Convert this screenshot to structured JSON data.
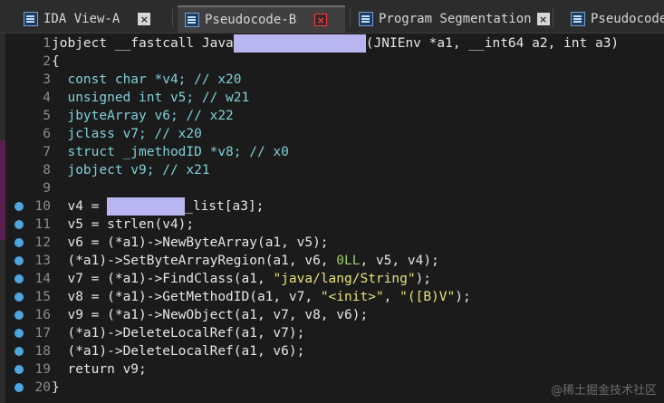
{
  "tabs": [
    {
      "label": "IDA View-A",
      "active": false,
      "close": "gray"
    },
    {
      "label": "Pseudocode-B",
      "active": true,
      "close": "red"
    },
    {
      "label": "Program Segmentation",
      "active": false,
      "close": "gray"
    },
    {
      "label": "Pseudocode",
      "active": false,
      "close": "none"
    }
  ],
  "close_glyph": "×",
  "code_lines": [
    {
      "n": "1",
      "bp": false,
      "parts": [
        [
          "kw",
          "jobject __fastcall Java"
        ],
        [
          "redact",
          ""
        ],
        [
          "kw",
          "(JNIEnv *a1, __int64 a2, int a3)"
        ]
      ]
    },
    {
      "n": "2",
      "bp": false,
      "parts": [
        [
          "kw",
          "{"
        ]
      ]
    },
    {
      "n": "3",
      "bp": false,
      "parts": [
        [
          "cmt",
          "  const char *v4; // x20"
        ]
      ]
    },
    {
      "n": "4",
      "bp": false,
      "parts": [
        [
          "cmt",
          "  unsigned int v5; // w21"
        ]
      ]
    },
    {
      "n": "5",
      "bp": false,
      "parts": [
        [
          "cmt",
          "  jbyteArray v6; // x22"
        ]
      ]
    },
    {
      "n": "6",
      "bp": false,
      "parts": [
        [
          "cmt",
          "  jclass v7; // x20"
        ]
      ]
    },
    {
      "n": "7",
      "bp": false,
      "parts": [
        [
          "cmt",
          "  struct _jmethodID *v8; // x0"
        ]
      ]
    },
    {
      "n": "8",
      "bp": false,
      "parts": [
        [
          "cmt",
          "  jobject v9; // x21"
        ]
      ]
    },
    {
      "n": "9",
      "bp": false,
      "parts": [
        [
          "kw",
          ""
        ]
      ]
    },
    {
      "n": "10",
      "bp": true,
      "parts": [
        [
          "kw",
          "  v4 = "
        ],
        [
          "redact",
          ""
        ],
        [
          "kw",
          "_list[a3];"
        ]
      ]
    },
    {
      "n": "11",
      "bp": true,
      "parts": [
        [
          "kw",
          "  v5 = strlen(v4);"
        ]
      ]
    },
    {
      "n": "12",
      "bp": true,
      "parts": [
        [
          "kw",
          "  v6 = (*a1)->NewByteArray(a1, v5);"
        ]
      ]
    },
    {
      "n": "13",
      "bp": true,
      "parts": [
        [
          "kw",
          "  (*a1)->SetByteArrayRegion(a1, v6, "
        ],
        [
          "num",
          "0LL"
        ],
        [
          "kw",
          ", v5, v4);"
        ]
      ]
    },
    {
      "n": "14",
      "bp": true,
      "parts": [
        [
          "kw",
          "  v7 = (*a1)->FindClass(a1, "
        ],
        [
          "str",
          "\"java/lang/String\""
        ],
        [
          "kw",
          ");"
        ]
      ]
    },
    {
      "n": "15",
      "bp": true,
      "parts": [
        [
          "kw",
          "  v8 = (*a1)->GetMethodID(a1, v7, "
        ],
        [
          "str",
          "\"<init>\""
        ],
        [
          "kw",
          ", "
        ],
        [
          "str",
          "\"([B)V\""
        ],
        [
          "kw",
          ");"
        ]
      ]
    },
    {
      "n": "16",
      "bp": true,
      "parts": [
        [
          "kw",
          "  v9 = (*a1)->NewObject(a1, v7, v8, v6);"
        ]
      ]
    },
    {
      "n": "17",
      "bp": true,
      "parts": [
        [
          "kw",
          "  (*a1)->DeleteLocalRef(a1, v7);"
        ]
      ]
    },
    {
      "n": "18",
      "bp": true,
      "parts": [
        [
          "kw",
          "  (*a1)->DeleteLocalRef(a1, v6);"
        ]
      ]
    },
    {
      "n": "19",
      "bp": true,
      "parts": [
        [
          "kw",
          "  return v9;"
        ]
      ]
    },
    {
      "n": "20",
      "bp": true,
      "parts": [
        [
          "kw",
          "}"
        ]
      ]
    }
  ],
  "watermark": "@稀土掘金技术社区",
  "colors": {
    "breakpoint": "#4ea6e0",
    "redaction": "#b9b5f0",
    "string": "#e6e37a",
    "comment": "#7fd0d8"
  }
}
